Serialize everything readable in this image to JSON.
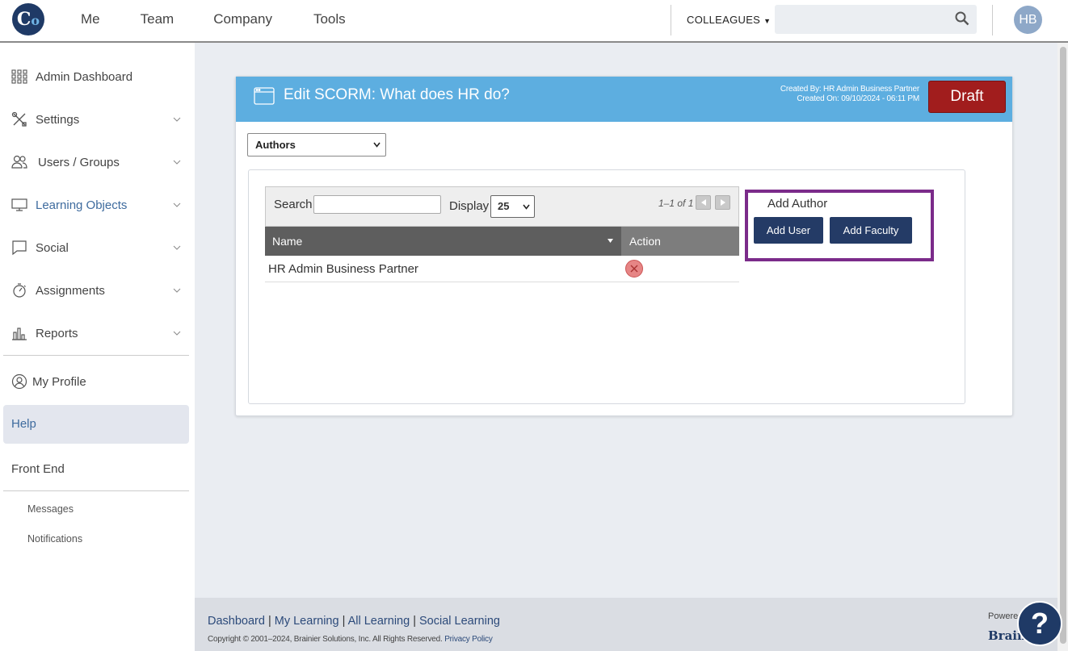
{
  "top_nav": {
    "items": [
      "Me",
      "Team",
      "Company",
      "Tools"
    ],
    "colleagues_label": "COLLEAGUES",
    "search_placeholder": "",
    "avatar_initials": "HB"
  },
  "sidebar": {
    "items": [
      {
        "label": "Admin Dashboard",
        "icon": "grid-icon"
      },
      {
        "label": "Settings",
        "icon": "tools-icon"
      },
      {
        "label": "Users / Groups",
        "icon": "users-icon"
      },
      {
        "label": "Learning Objects",
        "icon": "monitor-icon"
      },
      {
        "label": "Social",
        "icon": "chat-icon"
      },
      {
        "label": "Assignments",
        "icon": "stopwatch-icon"
      },
      {
        "label": "Reports",
        "icon": "bar-chart-icon"
      }
    ],
    "my_profile": "My Profile",
    "help": "Help",
    "front_end": "Front End",
    "messages": "Messages",
    "notifications": "Notifications"
  },
  "card": {
    "title": "Edit SCORM: What does HR do?",
    "created_by": "Created By: HR Admin Business Partner",
    "created_on": "Created On: 09/10/2024 - 06:11 PM",
    "status_button": "Draft",
    "section_select": "Authors"
  },
  "grid": {
    "search_label": "Search",
    "search_value": "",
    "display_label": "Display",
    "display_value": "25",
    "pager_text": "1–1 of 1",
    "col_name": "Name",
    "col_action": "Action",
    "rows": [
      {
        "name": "HR Admin Business Partner"
      }
    ]
  },
  "add_author": {
    "heading": "Add Author",
    "add_user": "Add User",
    "add_faculty": "Add Faculty"
  },
  "footer": {
    "links": [
      "Dashboard",
      "My Learning",
      "All Learning",
      "Social Learning"
    ],
    "copyright": "Copyright © 2001–2024, Brainier Solutions, Inc. All Rights Reserved.",
    "privacy": "Privacy Policy",
    "powered": "Powered",
    "brand": "Brain"
  },
  "colors": {
    "header_blue": "#5daee0",
    "draft_red": "#a11d1d",
    "navy": "#243b66",
    "highlight_purple": "#7b2b8a"
  }
}
